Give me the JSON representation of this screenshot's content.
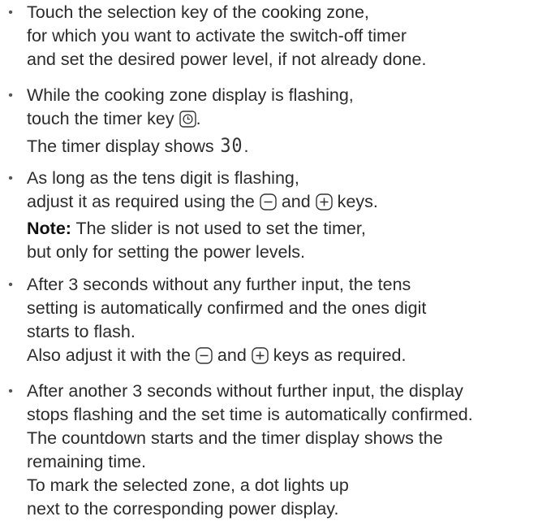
{
  "bullet_char": "•",
  "icons": {
    "timer": "timer-icon (clock symbol in rounded square)",
    "minus": "minus-key-icon (minus in rounded square)",
    "plus": "plus-key-icon (plus in rounded square)"
  },
  "b1": {
    "l1": "Touch the selection key of the cooking zone,",
    "l2": "for which you want to activate the switch-off timer",
    "l3": "and set the desired power level, if not already done."
  },
  "b2": {
    "l1": "While the cooking zone display is flashing,",
    "l2_pre": "touch the timer key ",
    "l2_post": ".",
    "l3_pre": "The timer display shows ",
    "display_value": "30",
    "l3_post": "."
  },
  "b3": {
    "l1": "As long as the tens digit is flashing,",
    "l2_a": "adjust it as required using the ",
    "l2_b": " and ",
    "l2_c": " keys.",
    "note_label": "Note:",
    "note_text": " The slider is not used to set the timer,",
    "l4": "but only for setting the power levels."
  },
  "b4": {
    "l1": "After 3 seconds without any further input, the tens",
    "l2": "setting is automatically confirmed and the ones digit",
    "l3": "starts to flash.",
    "l4_a": "Also adjust it with  the ",
    "l4_b": " and ",
    "l4_c": " keys as required."
  },
  "b5": {
    "l1": "After another 3 seconds  without further input, the display",
    "l2": "stops flashing and the set time is automatically confirmed.",
    "l3": "The countdown starts and the timer display shows the",
    "l4": "remaining time.",
    "l5": "To mark the selected zone, a dot lights up",
    "l6": "next to the corresponding power display."
  }
}
